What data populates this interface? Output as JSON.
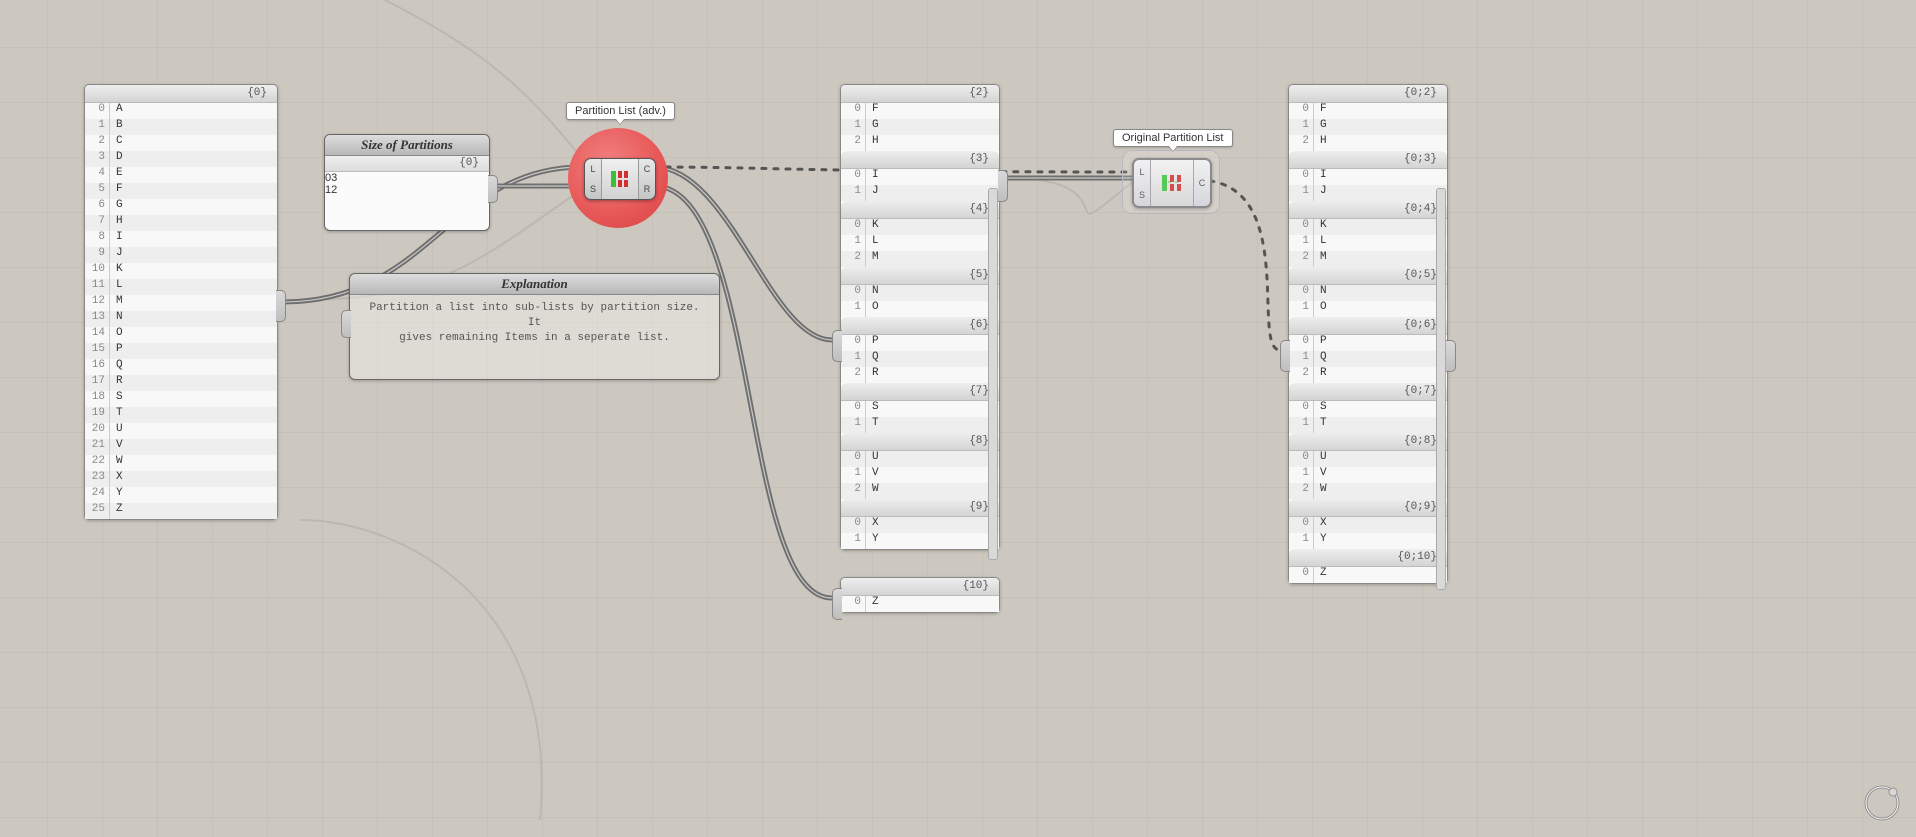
{
  "panels": {
    "alphabet": {
      "header": "{0}",
      "items": [
        "A",
        "B",
        "C",
        "D",
        "E",
        "F",
        "G",
        "H",
        "I",
        "J",
        "K",
        "L",
        "M",
        "N",
        "O",
        "P",
        "Q",
        "R",
        "S",
        "T",
        "U",
        "V",
        "W",
        "X",
        "Y",
        "Z"
      ]
    },
    "sizes": {
      "title": "Size of Partitions",
      "header": "{0}",
      "items": [
        "3",
        "2"
      ]
    },
    "explanation": {
      "title": "Explanation",
      "text1": "Partition a list into sub-lists by partition size. It",
      "text2": "gives remaining Items in a seperate list."
    },
    "result_left": {
      "groups": [
        {
          "header": "{2}",
          "items": [
            "F",
            "G",
            "H"
          ]
        },
        {
          "header": "{3}",
          "items": [
            "I",
            "J"
          ]
        },
        {
          "header": "{4}",
          "items": [
            "K",
            "L",
            "M"
          ]
        },
        {
          "header": "{5}",
          "items": [
            "N",
            "O"
          ]
        },
        {
          "header": "{6}",
          "items": [
            "P",
            "Q",
            "R"
          ]
        },
        {
          "header": "{7}",
          "items": [
            "S",
            "T"
          ]
        },
        {
          "header": "{8}",
          "items": [
            "U",
            "V",
            "W"
          ]
        },
        {
          "header": "{9}",
          "items": [
            "X",
            "Y"
          ]
        }
      ]
    },
    "remainder": {
      "header": "{10}",
      "items": [
        "Z"
      ]
    },
    "result_right": {
      "groups": [
        {
          "header": "{0;2}",
          "items": [
            "F",
            "G",
            "H"
          ]
        },
        {
          "header": "{0;3}",
          "items": [
            "I",
            "J"
          ]
        },
        {
          "header": "{0;4}",
          "items": [
            "K",
            "L",
            "M"
          ]
        },
        {
          "header": "{0;5}",
          "items": [
            "N",
            "O"
          ]
        },
        {
          "header": "{0;6}",
          "items": [
            "P",
            "Q",
            "R"
          ]
        },
        {
          "header": "{0;7}",
          "items": [
            "S",
            "T"
          ]
        },
        {
          "header": "{0;8}",
          "items": [
            "U",
            "V",
            "W"
          ]
        },
        {
          "header": "{0;9}",
          "items": [
            "X",
            "Y"
          ]
        },
        {
          "header": "{0;10}",
          "items": [
            "Z"
          ]
        }
      ]
    }
  },
  "tips": {
    "adv": "Partition List (adv.)",
    "orig": "Original Partition List"
  },
  "ports": {
    "L": "L",
    "S": "S",
    "C": "C",
    "R": "R"
  }
}
